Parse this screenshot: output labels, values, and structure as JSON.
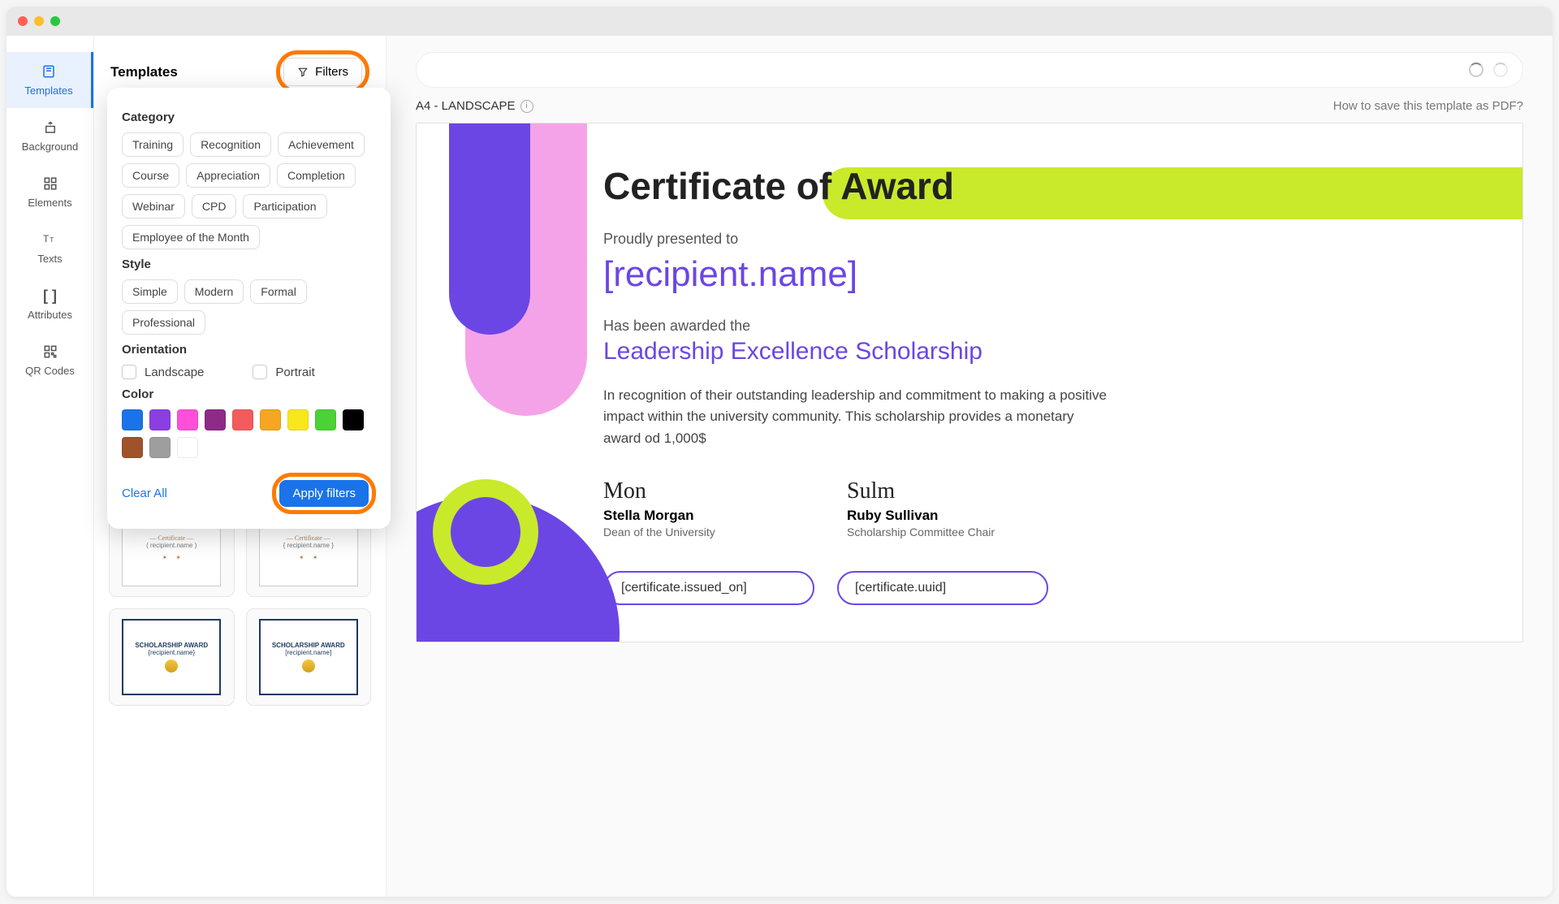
{
  "nav": {
    "items": [
      {
        "label": "Templates"
      },
      {
        "label": "Background"
      },
      {
        "label": "Elements"
      },
      {
        "label": "Texts"
      },
      {
        "label": "Attributes"
      },
      {
        "label": "QR Codes"
      }
    ]
  },
  "panel": {
    "title": "Templates",
    "filters_btn": "Filters"
  },
  "filters": {
    "category_title": "Category",
    "categories": [
      "Training",
      "Recognition",
      "Achievement",
      "Course",
      "Appreciation",
      "Completion",
      "Webinar",
      "CPD",
      "Participation",
      "Employee of the Month"
    ],
    "style_title": "Style",
    "styles": [
      "Simple",
      "Modern",
      "Formal",
      "Professional"
    ],
    "orientation_title": "Orientation",
    "orientation": {
      "landscape": "Landscape",
      "portrait": "Portrait"
    },
    "color_title": "Color",
    "colors": [
      "#1a73e8",
      "#8b3fe0",
      "#ff4fd8",
      "#8e2a87",
      "#f25c5c",
      "#f5a623",
      "#f8e71c",
      "#4cd137",
      "#000000",
      "#a0522d",
      "#9e9e9e",
      "#ffffff"
    ],
    "clear": "Clear All",
    "apply": "Apply filters"
  },
  "thumbs": {
    "t3_label": "SCHOLARSHIP AWARD",
    "t3_recipient": "{recipient.name}",
    "t4_label": "SCHOLARSHIP AWARD",
    "t4_recipient": "[recipient.name]"
  },
  "canvas": {
    "size_label": "A4 - LANDSCAPE",
    "help_link": "How to save this template as PDF?"
  },
  "cert": {
    "title_pre": "Certificate of ",
    "title_accent": "Award",
    "presented": "Proudly presented to",
    "recipient": "[recipient.name]",
    "awarded_pre": "Has been awarded the",
    "scholarship": "Leadership Excellence Scholarship",
    "recognition": "In recognition of their outstanding leadership and commitment to making a positive impact within the university community. This scholarship provides a monetary award od 1,000$",
    "sign1_sig": "Mon",
    "sign1_name": "Stella Morgan",
    "sign1_role": "Dean of the University",
    "sign2_sig": "Sulm",
    "sign2_name": "Ruby Sullivan",
    "sign2_role": "Scholarship Committee Chair",
    "attr_issued": "[certificate.issued_on]",
    "attr_uuid": "[certificate.uuid]"
  }
}
